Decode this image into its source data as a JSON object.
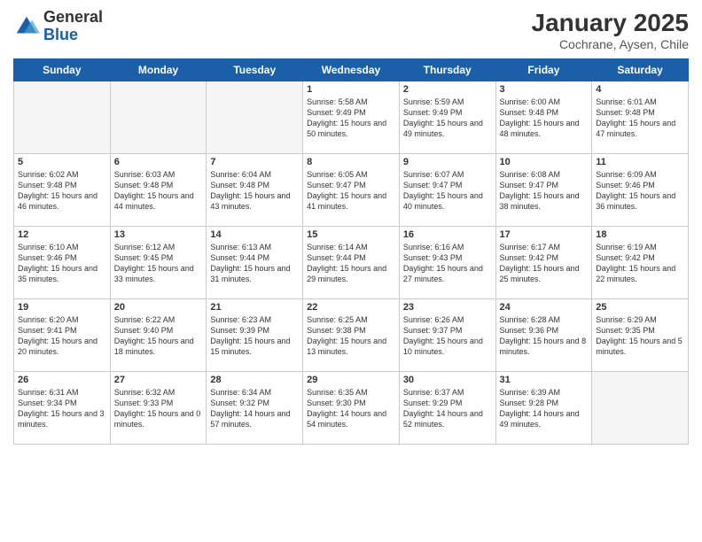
{
  "header": {
    "logo_general": "General",
    "logo_blue": "Blue",
    "title": "January 2025",
    "location": "Cochrane, Aysen, Chile"
  },
  "days_of_week": [
    "Sunday",
    "Monday",
    "Tuesday",
    "Wednesday",
    "Thursday",
    "Friday",
    "Saturday"
  ],
  "weeks": [
    [
      {
        "day": "",
        "empty": true
      },
      {
        "day": "",
        "empty": true
      },
      {
        "day": "",
        "empty": true
      },
      {
        "day": "1",
        "sunrise": "5:58 AM",
        "sunset": "9:49 PM",
        "daylight": "15 hours and 50 minutes."
      },
      {
        "day": "2",
        "sunrise": "5:59 AM",
        "sunset": "9:49 PM",
        "daylight": "15 hours and 49 minutes."
      },
      {
        "day": "3",
        "sunrise": "6:00 AM",
        "sunset": "9:48 PM",
        "daylight": "15 hours and 48 minutes."
      },
      {
        "day": "4",
        "sunrise": "6:01 AM",
        "sunset": "9:48 PM",
        "daylight": "15 hours and 47 minutes."
      }
    ],
    [
      {
        "day": "5",
        "sunrise": "6:02 AM",
        "sunset": "9:48 PM",
        "daylight": "15 hours and 46 minutes."
      },
      {
        "day": "6",
        "sunrise": "6:03 AM",
        "sunset": "9:48 PM",
        "daylight": "15 hours and 44 minutes."
      },
      {
        "day": "7",
        "sunrise": "6:04 AM",
        "sunset": "9:48 PM",
        "daylight": "15 hours and 43 minutes."
      },
      {
        "day": "8",
        "sunrise": "6:05 AM",
        "sunset": "9:47 PM",
        "daylight": "15 hours and 41 minutes."
      },
      {
        "day": "9",
        "sunrise": "6:07 AM",
        "sunset": "9:47 PM",
        "daylight": "15 hours and 40 minutes."
      },
      {
        "day": "10",
        "sunrise": "6:08 AM",
        "sunset": "9:47 PM",
        "daylight": "15 hours and 38 minutes."
      },
      {
        "day": "11",
        "sunrise": "6:09 AM",
        "sunset": "9:46 PM",
        "daylight": "15 hours and 36 minutes."
      }
    ],
    [
      {
        "day": "12",
        "sunrise": "6:10 AM",
        "sunset": "9:46 PM",
        "daylight": "15 hours and 35 minutes."
      },
      {
        "day": "13",
        "sunrise": "6:12 AM",
        "sunset": "9:45 PM",
        "daylight": "15 hours and 33 minutes."
      },
      {
        "day": "14",
        "sunrise": "6:13 AM",
        "sunset": "9:44 PM",
        "daylight": "15 hours and 31 minutes."
      },
      {
        "day": "15",
        "sunrise": "6:14 AM",
        "sunset": "9:44 PM",
        "daylight": "15 hours and 29 minutes."
      },
      {
        "day": "16",
        "sunrise": "6:16 AM",
        "sunset": "9:43 PM",
        "daylight": "15 hours and 27 minutes."
      },
      {
        "day": "17",
        "sunrise": "6:17 AM",
        "sunset": "9:42 PM",
        "daylight": "15 hours and 25 minutes."
      },
      {
        "day": "18",
        "sunrise": "6:19 AM",
        "sunset": "9:42 PM",
        "daylight": "15 hours and 22 minutes."
      }
    ],
    [
      {
        "day": "19",
        "sunrise": "6:20 AM",
        "sunset": "9:41 PM",
        "daylight": "15 hours and 20 minutes."
      },
      {
        "day": "20",
        "sunrise": "6:22 AM",
        "sunset": "9:40 PM",
        "daylight": "15 hours and 18 minutes."
      },
      {
        "day": "21",
        "sunrise": "6:23 AM",
        "sunset": "9:39 PM",
        "daylight": "15 hours and 15 minutes."
      },
      {
        "day": "22",
        "sunrise": "6:25 AM",
        "sunset": "9:38 PM",
        "daylight": "15 hours and 13 minutes."
      },
      {
        "day": "23",
        "sunrise": "6:26 AM",
        "sunset": "9:37 PM",
        "daylight": "15 hours and 10 minutes."
      },
      {
        "day": "24",
        "sunrise": "6:28 AM",
        "sunset": "9:36 PM",
        "daylight": "15 hours and 8 minutes."
      },
      {
        "day": "25",
        "sunrise": "6:29 AM",
        "sunset": "9:35 PM",
        "daylight": "15 hours and 5 minutes."
      }
    ],
    [
      {
        "day": "26",
        "sunrise": "6:31 AM",
        "sunset": "9:34 PM",
        "daylight": "15 hours and 3 minutes."
      },
      {
        "day": "27",
        "sunrise": "6:32 AM",
        "sunset": "9:33 PM",
        "daylight": "15 hours and 0 minutes."
      },
      {
        "day": "28",
        "sunrise": "6:34 AM",
        "sunset": "9:32 PM",
        "daylight": "14 hours and 57 minutes."
      },
      {
        "day": "29",
        "sunrise": "6:35 AM",
        "sunset": "9:30 PM",
        "daylight": "14 hours and 54 minutes."
      },
      {
        "day": "30",
        "sunrise": "6:37 AM",
        "sunset": "9:29 PM",
        "daylight": "14 hours and 52 minutes."
      },
      {
        "day": "31",
        "sunrise": "6:39 AM",
        "sunset": "9:28 PM",
        "daylight": "14 hours and 49 minutes."
      },
      {
        "day": "",
        "empty": true
      }
    ]
  ],
  "labels": {
    "sunrise": "Sunrise:",
    "sunset": "Sunset:",
    "daylight": "Daylight:"
  }
}
